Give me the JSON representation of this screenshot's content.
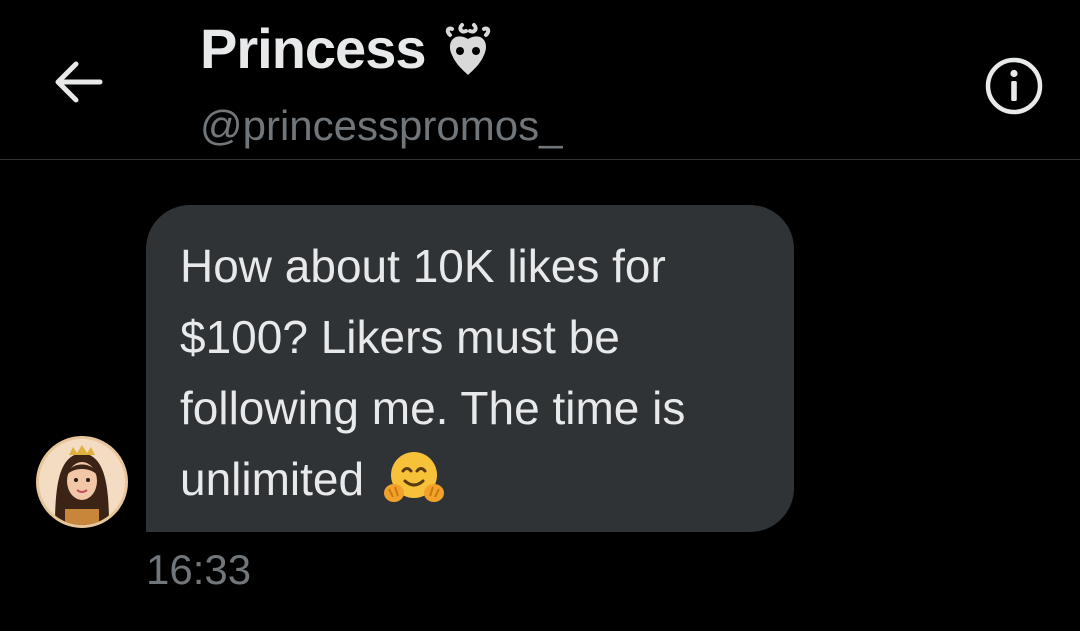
{
  "header": {
    "back_icon": "arrow-left-icon",
    "title": "Princess",
    "title_emoji": "🪬",
    "handle": "@princesspromos_",
    "info_icon": "info-icon"
  },
  "conversation": {
    "messages": [
      {
        "text": "How about 10K likes for $100? Likers must be following me. The time is unlimited",
        "emoji": "🤗",
        "time": "16:33",
        "direction": "incoming"
      }
    ]
  },
  "colors": {
    "background": "#000000",
    "bubble": "#2f3336",
    "text": "#e7e9ea",
    "muted": "#71767b"
  }
}
